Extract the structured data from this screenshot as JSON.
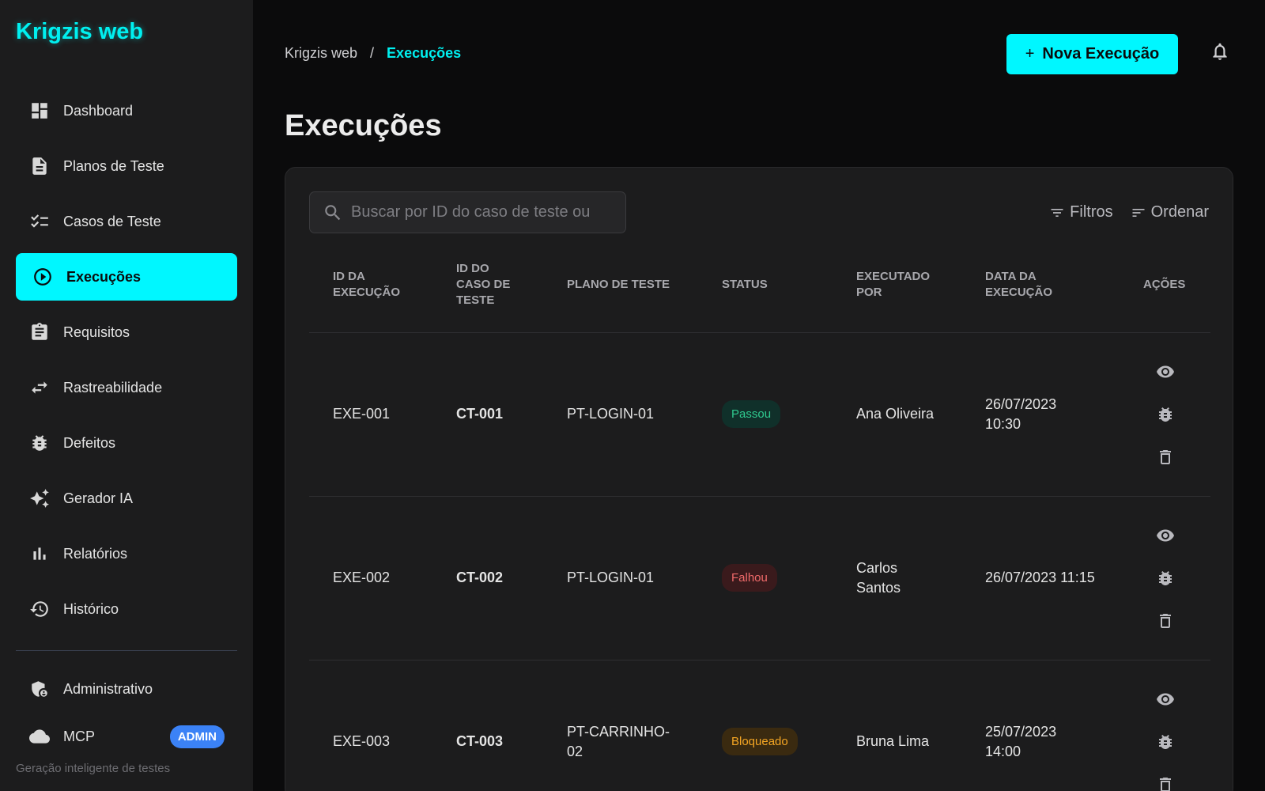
{
  "app": {
    "title": "Krigzis web"
  },
  "sidebar": {
    "items": [
      {
        "label": "Dashboard",
        "icon": "dashboard-icon"
      },
      {
        "label": "Planos de Teste",
        "icon": "document-icon"
      },
      {
        "label": "Casos de Teste",
        "icon": "checklist-icon"
      },
      {
        "label": "Execuções",
        "icon": "play-circle-icon",
        "active": true
      },
      {
        "label": "Requisitos",
        "icon": "clipboard-icon"
      },
      {
        "label": "Rastreabilidade",
        "icon": "swap-arrows-icon"
      },
      {
        "label": "Defeitos",
        "icon": "bug-icon"
      },
      {
        "label": "Gerador IA",
        "icon": "sparkles-icon"
      },
      {
        "label": "Relatórios",
        "icon": "bar-chart-icon"
      },
      {
        "label": "Histórico",
        "icon": "history-icon"
      }
    ],
    "bottom": [
      {
        "label": "Administrativo",
        "icon": "admin-shield-icon"
      },
      {
        "label": "MCP",
        "icon": "cloud-icon",
        "badge": "ADMIN"
      }
    ],
    "tagline": "Geração inteligente de testes"
  },
  "breadcrumb": {
    "root": "Krigzis web",
    "separator": "/",
    "current": "Execuções"
  },
  "header": {
    "new_button_label": "Nova Execução",
    "new_button_icon": "+"
  },
  "page": {
    "title": "Execuções"
  },
  "search": {
    "placeholder": "Buscar por ID do caso de teste ou",
    "value": ""
  },
  "toolbar": {
    "filters_label": "Filtros",
    "sort_label": "Ordenar"
  },
  "table": {
    "columns": [
      "ID DA EXECUÇÃO",
      "ID DO CASO DE TESTE",
      "PLANO DE TESTE",
      "STATUS",
      "EXECUTADO POR",
      "DATA DA EXECUÇÃO",
      "AÇÕES"
    ],
    "rows": [
      {
        "exec_id": "EXE-001",
        "case_id": "CT-001",
        "plan": "PT-LOGIN-01",
        "status": "Passou",
        "status_type": "pass",
        "executed_by": "Ana Oliveira",
        "date": "26/07/2023 10:30"
      },
      {
        "exec_id": "EXE-002",
        "case_id": "CT-002",
        "plan": "PT-LOGIN-01",
        "status": "Falhou",
        "status_type": "fail",
        "executed_by": "Carlos Santos",
        "date": "26/07/2023 11:15"
      },
      {
        "exec_id": "EXE-003",
        "case_id": "CT-003",
        "plan": "PT-CARRINHO-02",
        "status": "Bloqueado",
        "status_type": "block",
        "executed_by": "Bruna Lima",
        "date": "25/07/2023 14:00"
      }
    ]
  },
  "colors": {
    "accent": "#00f7ff",
    "pass": "#2fc98f",
    "fail": "#f06a6a",
    "blocked": "#f5a623",
    "admin_badge": "#3b82f6"
  }
}
